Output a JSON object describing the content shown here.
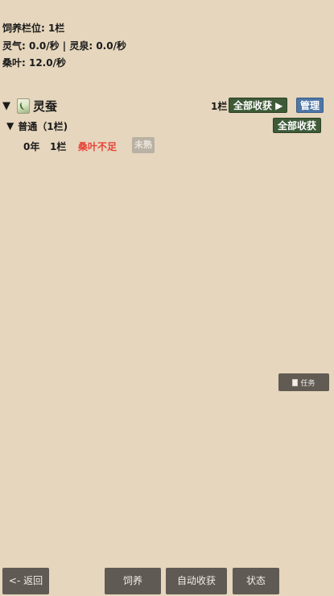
{
  "stats": {
    "slots": "饲养栏位: 1栏",
    "spirit": "灵气: 0.0/秒 | 灵泉: 0.0/秒",
    "mulberry": "桑叶: 12.0/秒"
  },
  "category": {
    "toggle": "▼",
    "title": "灵蚕",
    "icon": "silkworm-icon",
    "count": "1栏",
    "harvest_all": "全部收获 ▶",
    "manage": "管理"
  },
  "group": {
    "toggle": "▼",
    "title": "普通（1栏)",
    "harvest_all": "全部收获"
  },
  "slot": {
    "age": "0年",
    "count": "1栏",
    "warning": "桑叶不足",
    "status": "未熟"
  },
  "task": {
    "icon": "clipboard-icon",
    "label": "任务"
  },
  "bottom_nav": {
    "back": "<- 返回",
    "feed": "饲养",
    "auto_harvest": "自动收获",
    "status": "状态"
  },
  "colors": {
    "background": "#e5d6bd",
    "green_button": "#3e5a37",
    "blue_button": "#4e76a6",
    "warning": "#e8433a",
    "dark_button": "#5f5a53"
  }
}
